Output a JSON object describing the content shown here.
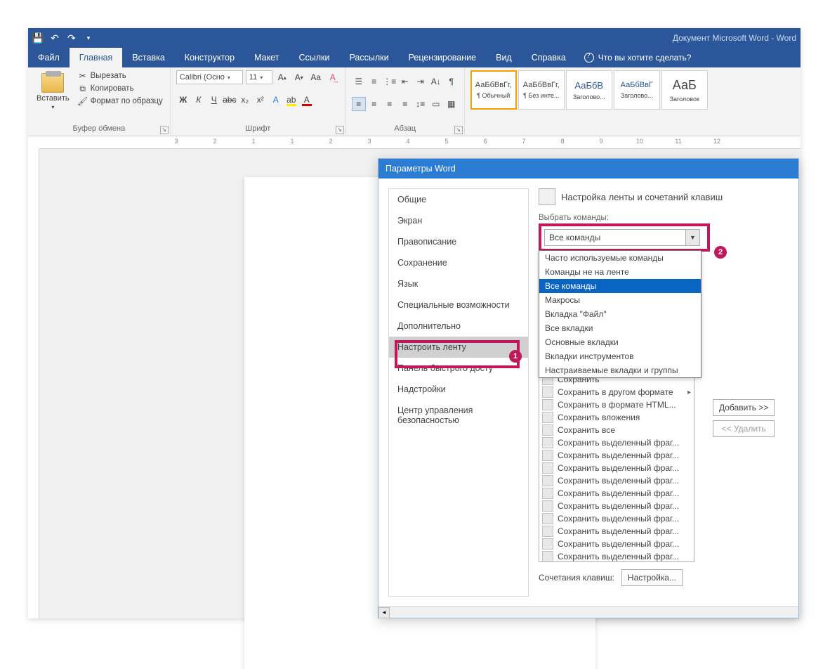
{
  "titlebar": {
    "doc_title": "Документ Microsoft Word  -  Word"
  },
  "tabs": {
    "file": "Файл",
    "home": "Главная",
    "insert": "Вставка",
    "design": "Конструктор",
    "layout": "Макет",
    "references": "Ссылки",
    "mailings": "Рассылки",
    "review": "Рецензирование",
    "view": "Вид",
    "help": "Справка",
    "tell_me": "Что вы хотите сделать?"
  },
  "ribbon": {
    "clipboard": {
      "paste": "Вставить",
      "cut": "Вырезать",
      "copy": "Копировать",
      "format_painter": "Формат по образцу",
      "group_label": "Буфер обмена"
    },
    "font": {
      "name": "Calibri (Осно",
      "size": "11",
      "group_label": "Шрифт"
    },
    "paragraph": {
      "group_label": "Абзац"
    },
    "styles": {
      "s1_sample": "АаБбВвГг,",
      "s1_name": "¶ Обычный",
      "s2_sample": "АаБбВвГг,",
      "s2_name": "¶ Без инте...",
      "s3_sample": "АаБбВ",
      "s3_name": "Заголово...",
      "s4_sample": "АаБбВвГ",
      "s4_name": "Заголово...",
      "s5_sample": "АаБ",
      "s5_name": "Заголовок"
    }
  },
  "dialog": {
    "title": "Параметры Word",
    "nav": {
      "general": "Общие",
      "display": "Экран",
      "proofing": "Правописание",
      "save": "Сохранение",
      "language": "Язык",
      "accessibility": "Специальные возможности",
      "advanced": "Дополнительно",
      "customize_ribbon": "Настроить ленту",
      "qat": "Панель быстрого досту",
      "addins": "Надстройки",
      "trust": "Центр управления безопасностью"
    },
    "right": {
      "heading": "Настройка ленты и сочетаний клавиш",
      "choose_from_label": "Выбрать команды:",
      "combo_value": "Все команды",
      "dropdown": {
        "frequent": "Часто используемые команды",
        "not_in_ribbon": "Команды не на ленте",
        "all": "Все команды",
        "macros": "Макросы",
        "file_tab": "Вкладка \"Файл\"",
        "all_tabs": "Все вкладки",
        "main_tabs": "Основные вкладки",
        "tool_tabs": "Вкладки инструментов",
        "custom_tabs": "Настраиваемые вкладки и группы"
      },
      "commands": [
        "Сохранить",
        "Сохранить в другом формате",
        "Сохранить в формате HTML...",
        "Сохранить вложения",
        "Сохранить все",
        "Сохранить выделенный фраг...",
        "Сохранить выделенный фраг...",
        "Сохранить выделенный фраг...",
        "Сохранить выделенный фраг...",
        "Сохранить выделенный фраг...",
        "Сохранить выделенный фраг...",
        "Сохранить выделенный фраг...",
        "Сохранить выделенный фраг...",
        "Сохранить выделенный фраг...",
        "Сохранить выделенный фраг...",
        "Сохранить выделенный фраг...",
        "Сохранить выделенный фраг..."
      ],
      "add_button": "Добавить >>",
      "remove_button": "<< Удалить",
      "shortcuts_label": "Сочетания клавиш:",
      "customize_button": "Настройка..."
    },
    "annotations": {
      "one": "1",
      "two": "2"
    }
  },
  "ruler_numbers": [
    "3",
    "2",
    "1",
    "1",
    "2",
    "3",
    "4",
    "5",
    "6",
    "7",
    "8",
    "9",
    "10",
    "11",
    "12"
  ]
}
